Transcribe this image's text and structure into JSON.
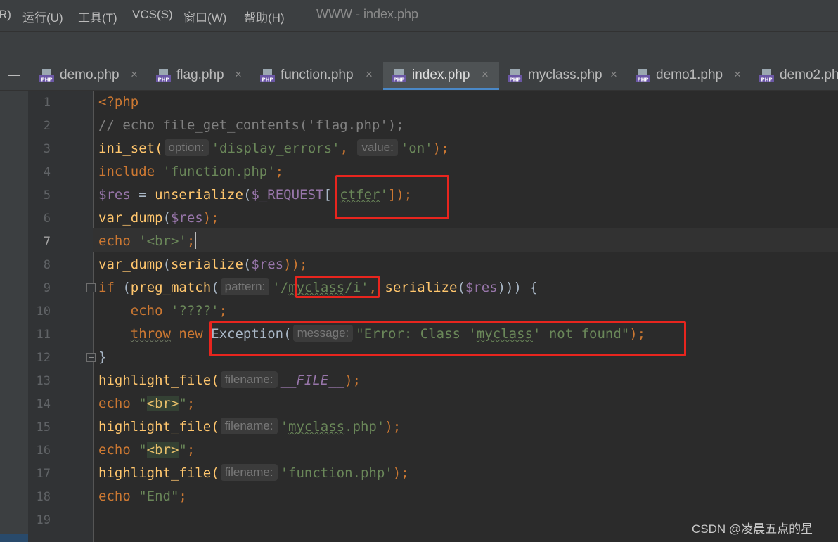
{
  "menubar": {
    "items": [
      "R)",
      "运行(U)",
      "工具(T)",
      "VCS(S)",
      "窗口(W)",
      "帮助(H)"
    ],
    "window_title": "WWW - index.php"
  },
  "tabs": [
    {
      "label": "demo.php",
      "close": "×"
    },
    {
      "label": "flag.php",
      "close": "×"
    },
    {
      "label": "function.php",
      "close": "×"
    },
    {
      "label": "index.php",
      "close": "×",
      "active": true
    },
    {
      "label": "myclass.php",
      "close": "×"
    },
    {
      "label": "demo1.php",
      "close": "×"
    },
    {
      "label": "demo2.ph",
      "close": ""
    }
  ],
  "editor": {
    "line_numbers": [
      "1",
      "2",
      "3",
      "4",
      "5",
      "6",
      "7",
      "8",
      "9",
      "10",
      "11",
      "12",
      "13",
      "14",
      "15",
      "16",
      "17",
      "18",
      "19"
    ],
    "current_line": "7",
    "hints": {
      "option": "option:",
      "value": "value:",
      "pattern": "pattern:",
      "message": "message:",
      "filename": "filename:"
    },
    "lines": {
      "l1": {
        "a": "<?php"
      },
      "l2": {
        "a": "// echo file_get_contents('flag.php');"
      },
      "l3": {
        "a": "ini_set(",
        "b": "'display_errors'",
        "c": ", ",
        "d": "'on'",
        "e": ");"
      },
      "l4": {
        "a": "include ",
        "b": "'function.php'",
        "c": ";"
      },
      "l5": {
        "a": "$res",
        "b": " = ",
        "c": "unserialize",
        "d": "(",
        "e": "$_REQUEST",
        "f": "[",
        "g": "'",
        "h": "ctfer",
        "i": "'",
        "j": "]);"
      },
      "l6": {
        "a": "var_dump",
        "b": "(",
        "c": "$res",
        "d": ");"
      },
      "l7": {
        "a": "echo ",
        "b": "'<br>'",
        "c": ";"
      },
      "l8": {
        "a": "var_dump",
        "b": "(",
        "c": "serialize",
        "d": "(",
        "e": "$res",
        "f": "));"
      },
      "l9": {
        "a": "if ",
        "b": "(",
        "c": "preg_match",
        "d": "(",
        "e": "'/",
        "f": "myclass",
        "g": "/i'",
        "h": ", ",
        "i": "serialize",
        "j": "(",
        "k": "$res",
        "l": "))) {"
      },
      "l10": {
        "a": "    echo ",
        "b": "'????'",
        "c": ";"
      },
      "l11": {
        "a": "    ",
        "b": "throw",
        "c": " new ",
        "d": "Exception(",
        "e": "\"Error: Class '",
        "f": "myclass",
        "g": "' not found\"",
        "h": ");"
      },
      "l12": {
        "a": "}"
      },
      "l13": {
        "a": "highlight_file(",
        "b": "__FILE__",
        "c": ");"
      },
      "l14": {
        "a": "echo ",
        "b": "\"",
        "c": "<br>",
        "d": "\"",
        "e": ";"
      },
      "l15": {
        "a": "highlight_file(",
        "b": "'",
        "c": "myclass",
        "d": ".php'",
        "e": ");"
      },
      "l16": {
        "a": "echo ",
        "b": "\"",
        "c": "<br>",
        "d": "\"",
        "e": ";"
      },
      "l17": {
        "a": "highlight_file(",
        "b": "'function.php'",
        "c": ");"
      },
      "l18": {
        "a": "echo ",
        "b": "\"End\"",
        "c": ";"
      }
    }
  },
  "watermark": "CSDN @凌晨五点的星",
  "colors": {
    "keyword": "#cc7832",
    "string": "#6a8759",
    "function": "#ffc66d",
    "variable": "#9876aa",
    "comment": "#808080",
    "annotation_box": "#e8251e",
    "active_tab_underline": "#4a88c7"
  }
}
